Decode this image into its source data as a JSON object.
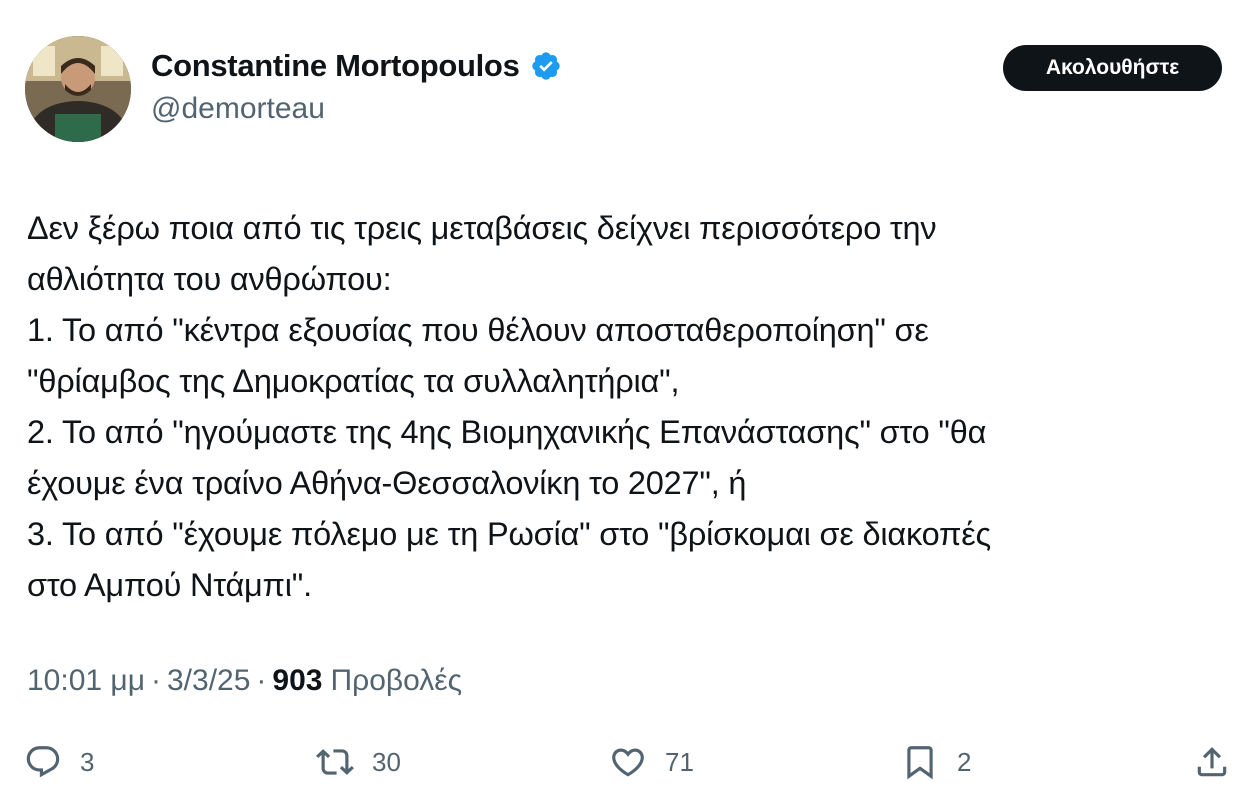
{
  "author": {
    "display_name": "Constantine Mortopoulos",
    "handle": "@demorteau",
    "verified": true
  },
  "follow_button_label": "Ακολουθήστε",
  "tweet": {
    "lines": [
      "Δεν ξέρω ποια από τις τρεις μεταβάσεις δείχνει περισσότερο την",
      "αθλιότητα του ανθρώπου:",
      "1. Το από \"κέντρα εξουσίας που θέλουν αποσταθεροποίηση\" σε",
      "\"θρίαμβος της Δημοκρατίας τα συλλαλητήρια\",",
      "2. Το από \"ηγούμαστε της 4ης Βιομηχανικής Επανάστασης\" στο \"θα",
      "έχουμε ένα τραίνο Αθήνα-Θεσσαλονίκη το 2027\", ή",
      "3. Το από \"έχουμε πόλεμο με τη Ρωσία\" στο \"βρίσκομαι σε διακοπές",
      "στο Αμπού Ντάμπι\"."
    ]
  },
  "meta": {
    "time": "10:01 μμ",
    "separator": "·",
    "date": "3/3/25",
    "views_count": "903",
    "views_label": "Προβολές"
  },
  "actions": {
    "replies": "3",
    "reposts": "30",
    "likes": "71",
    "bookmarks": "2"
  },
  "icons": [
    "verified-badge-icon",
    "reply-icon",
    "repost-icon",
    "like-icon",
    "bookmark-icon",
    "share-icon"
  ],
  "colors": {
    "verified_blue": "#1d9bf0",
    "text_primary": "#0f1419",
    "text_secondary": "#536471",
    "follow_button_bg": "#0f1419"
  }
}
